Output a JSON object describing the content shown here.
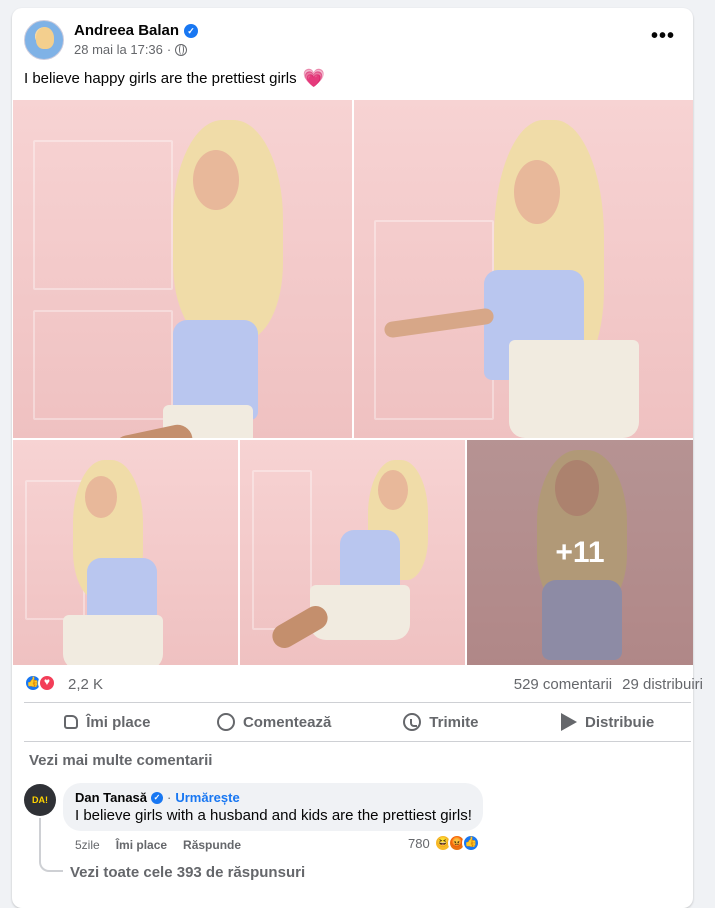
{
  "post": {
    "author": "Andreea Balan",
    "timestamp": "28 mai la 17:36",
    "separator": "·",
    "caption": "I believe happy girls are the prettiest girls",
    "caption_emoji": "💗",
    "more_icon": "more-horizontal-icon",
    "photos_more_count": "+11"
  },
  "reactions": {
    "count": "2,2 K",
    "comments": "529 comentarii",
    "shares": "29 distribuiri"
  },
  "actions": {
    "like": "Îmi place",
    "comment": "Comentează",
    "send": "Trimite",
    "share": "Distribuie"
  },
  "comments": {
    "see_more": "Vezi mai multe comentarii",
    "items": [
      {
        "author": "Dan Tanasă",
        "follow": "Urmărește",
        "text": "I believe girls with a husband and kids are the prettiest girls!",
        "time": "5zile",
        "like": "Îmi place",
        "reply": "Răspunde",
        "reaction_count": "780",
        "avatar_text": "DA!"
      }
    ],
    "see_replies": "Vezi toate cele 393 de răspunsuri"
  },
  "colors": {
    "accent": "#1877f2",
    "muted": "#65676b",
    "love": "#f33e58",
    "wall_pink": "#f2c8c8"
  }
}
